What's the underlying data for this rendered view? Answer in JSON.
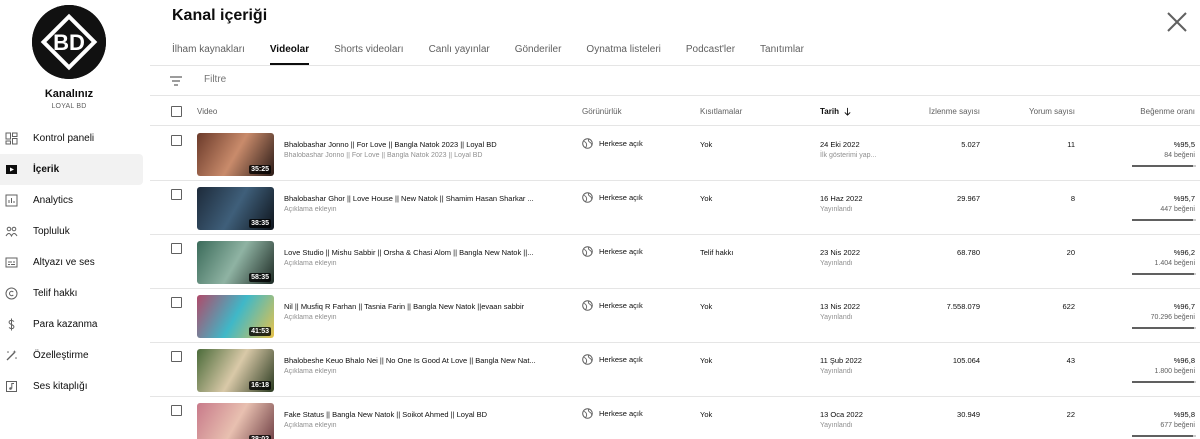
{
  "sidebar": {
    "channel_title": "Kanalınız",
    "channel_name": "LOYAL BD",
    "logo_text": "BD",
    "items": [
      {
        "label": "Kontrol paneli",
        "icon": "dashboard-icon"
      },
      {
        "label": "İçerik",
        "icon": "content-icon",
        "active": true
      },
      {
        "label": "Analytics",
        "icon": "analytics-icon"
      },
      {
        "label": "Topluluk",
        "icon": "community-icon"
      },
      {
        "label": "Altyazı ve ses",
        "icon": "subtitles-icon"
      },
      {
        "label": "Telif hakkı",
        "icon": "copyright-icon"
      },
      {
        "label": "Para kazanma",
        "icon": "monetization-icon"
      },
      {
        "label": "Özelleştirme",
        "icon": "customization-icon"
      },
      {
        "label": "Ses kitaplığı",
        "icon": "audio-library-icon"
      }
    ]
  },
  "header": {
    "title": "Kanal içeriği",
    "close_icon": "close-icon"
  },
  "tabs": [
    {
      "label": "İlham kaynakları"
    },
    {
      "label": "Videolar",
      "active": true
    },
    {
      "label": "Shorts videoları"
    },
    {
      "label": "Canlı yayınlar"
    },
    {
      "label": "Gönderiler"
    },
    {
      "label": "Oynatma listeleri"
    },
    {
      "label": "Podcast'ler"
    },
    {
      "label": "Tanıtımlar"
    }
  ],
  "filter": {
    "placeholder": "Filtre"
  },
  "columns": {
    "video": "Video",
    "visibility": "Görünürlük",
    "restrictions": "Kısıtlamalar",
    "date": "Tarih",
    "views": "İzlenme sayısı",
    "comments": "Yorum sayısı",
    "likes": "Beğenme oranı"
  },
  "rows": [
    {
      "title": "Bhalobashar Jonno || For Love || Bangla Natok 2023 || Loyal BD",
      "desc": "Bhalobashar Jonno || For Love || Bangla Natok 2023 || Loyal BD",
      "duration": "35:25",
      "visibility": "Herkese açık",
      "restriction": "Yok",
      "date": "24 Eki 2022",
      "date_sub": "İlk gösterimi yap...",
      "views": "5.027",
      "comments": "11",
      "like_pct": "%95,5",
      "like_count": "84 beğeni",
      "like_ratio": 0.955,
      "thumb_colors": [
        "#6b3a2a",
        "#c98b6b",
        "#2a1a16"
      ]
    },
    {
      "title": "Bhalobashar Ghor || Love House || New Natok || Shamim Hasan Sharkar ...",
      "desc": "Açıklama ekleyin",
      "duration": "38:35",
      "visibility": "Herkese açık",
      "restriction": "Yok",
      "date": "16 Haz 2022",
      "date_sub": "Yayınlandı",
      "views": "29.967",
      "comments": "8",
      "like_pct": "%95,7",
      "like_count": "447 beğeni",
      "like_ratio": 0.957,
      "thumb_colors": [
        "#1d2a3a",
        "#3f5f7a",
        "#0e141c"
      ]
    },
    {
      "title": "Love Studio || Mishu Sabbir || Orsha & Chasi Alom || Bangla New Natok ||...",
      "desc": "Açıklama ekleyin",
      "duration": "58:35",
      "visibility": "Herkese açık",
      "restriction": "Telif hakkı",
      "date": "23 Nis 2022",
      "date_sub": "Yayınlandı",
      "views": "68.780",
      "comments": "20",
      "like_pct": "%96,2",
      "like_count": "1.404 beğeni",
      "like_ratio": 0.962,
      "thumb_colors": [
        "#3b6b5a",
        "#8fb3a3",
        "#1d2a24"
      ]
    },
    {
      "title": "Nil || Musfiq R Farhan || Tasnia Farin || Bangla New Natok ||evaan sabbir",
      "desc": "Açıklama ekleyin",
      "duration": "41:53",
      "visibility": "Herkese açık",
      "restriction": "Yok",
      "date": "13 Nis 2022",
      "date_sub": "Yayınlandı",
      "views": "7.558.079",
      "comments": "622",
      "like_pct": "%96,7",
      "like_count": "70.296 beğeni",
      "like_ratio": 0.967,
      "thumb_colors": [
        "#b04a6a",
        "#3fb8c8",
        "#e7c24a"
      ]
    },
    {
      "title": "Bhalobeshe Keuo Bhalo Nei || No One Is Good At Love || Bangla New Nat...",
      "desc": "Açıklama ekleyin",
      "duration": "16:18",
      "visibility": "Herkese açık",
      "restriction": "Yok",
      "date": "11 Şub 2022",
      "date_sub": "Yayınlandı",
      "views": "105.064",
      "comments": "43",
      "like_pct": "%96,8",
      "like_count": "1.800 beğeni",
      "like_ratio": 0.968,
      "thumb_colors": [
        "#4b6b3a",
        "#d9c9a8",
        "#2a3a20"
      ]
    },
    {
      "title": "Fake Status || Bangla New Natok || Soikot Ahmed || Loyal BD",
      "desc": "Açıklama ekleyin",
      "duration": "28:02",
      "visibility": "Herkese açık",
      "restriction": "Yok",
      "date": "13 Oca 2022",
      "date_sub": "Yayınlandı",
      "views": "30.949",
      "comments": "22",
      "like_pct": "%95,8",
      "like_count": "677 beğeni",
      "like_ratio": 0.958,
      "thumb_colors": [
        "#c87a8a",
        "#e8c0b0",
        "#6a3a40"
      ]
    }
  ]
}
